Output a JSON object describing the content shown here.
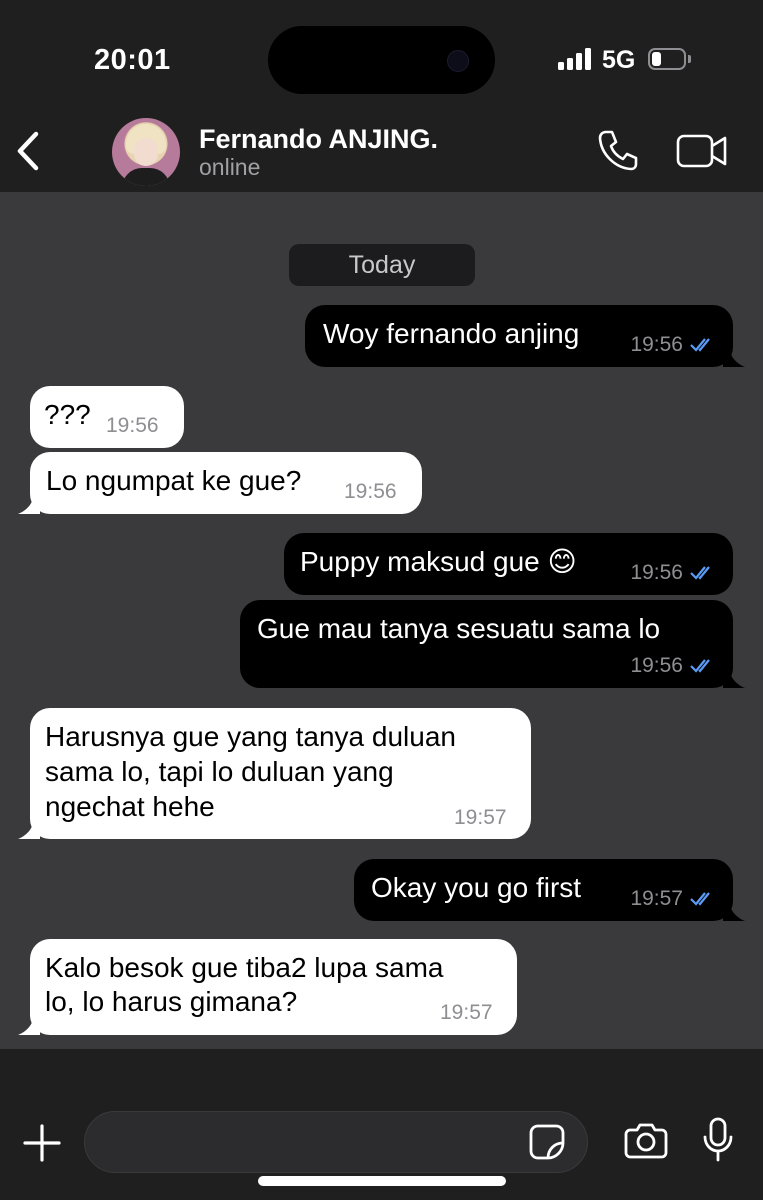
{
  "status_bar": {
    "time": "20:01",
    "network": "5G",
    "battery_level": 0.3
  },
  "header": {
    "contact_name": "Fernando ANJING.",
    "contact_status": "online",
    "icons": [
      "chevron-left-icon",
      "phone-icon",
      "video-camera-icon"
    ]
  },
  "chat": {
    "date_label": "Today",
    "messages": [
      {
        "direction": "outgoing",
        "lines": [
          "Woy fernando anjing"
        ],
        "time": "19:56",
        "read": true
      },
      {
        "direction": "incoming",
        "lines": [
          "???"
        ],
        "time": "19:56"
      },
      {
        "direction": "incoming",
        "lines": [
          "Lo ngumpat ke gue?"
        ],
        "time": "19:56"
      },
      {
        "direction": "outgoing",
        "lines": [
          "Puppy maksud gue 😊"
        ],
        "time": "19:56",
        "read": true
      },
      {
        "direction": "outgoing",
        "lines": [
          "Gue mau tanya sesuatu sama lo"
        ],
        "time": "19:56",
        "read": true
      },
      {
        "direction": "incoming",
        "lines": [
          "Harusnya gue yang tanya duluan",
          "sama lo, tapi lo duluan yang",
          "ngechat hehe"
        ],
        "time": "19:57"
      },
      {
        "direction": "outgoing",
        "lines": [
          "Okay you go first"
        ],
        "time": "19:57",
        "read": true
      },
      {
        "direction": "incoming",
        "lines": [
          "Kalo besok gue tiba2 lupa sama",
          "lo, lo harus gimana?"
        ],
        "time": "19:57"
      }
    ]
  },
  "composer": {
    "value": "",
    "icons": [
      "plus-icon",
      "sticker-icon",
      "camera-icon",
      "microphone-icon"
    ]
  },
  "colors": {
    "outgoing_bubble": "#000000",
    "incoming_bubble": "#ffffff",
    "chat_background": "#3a3a3c",
    "read_ticks": "#5b9cf5"
  }
}
